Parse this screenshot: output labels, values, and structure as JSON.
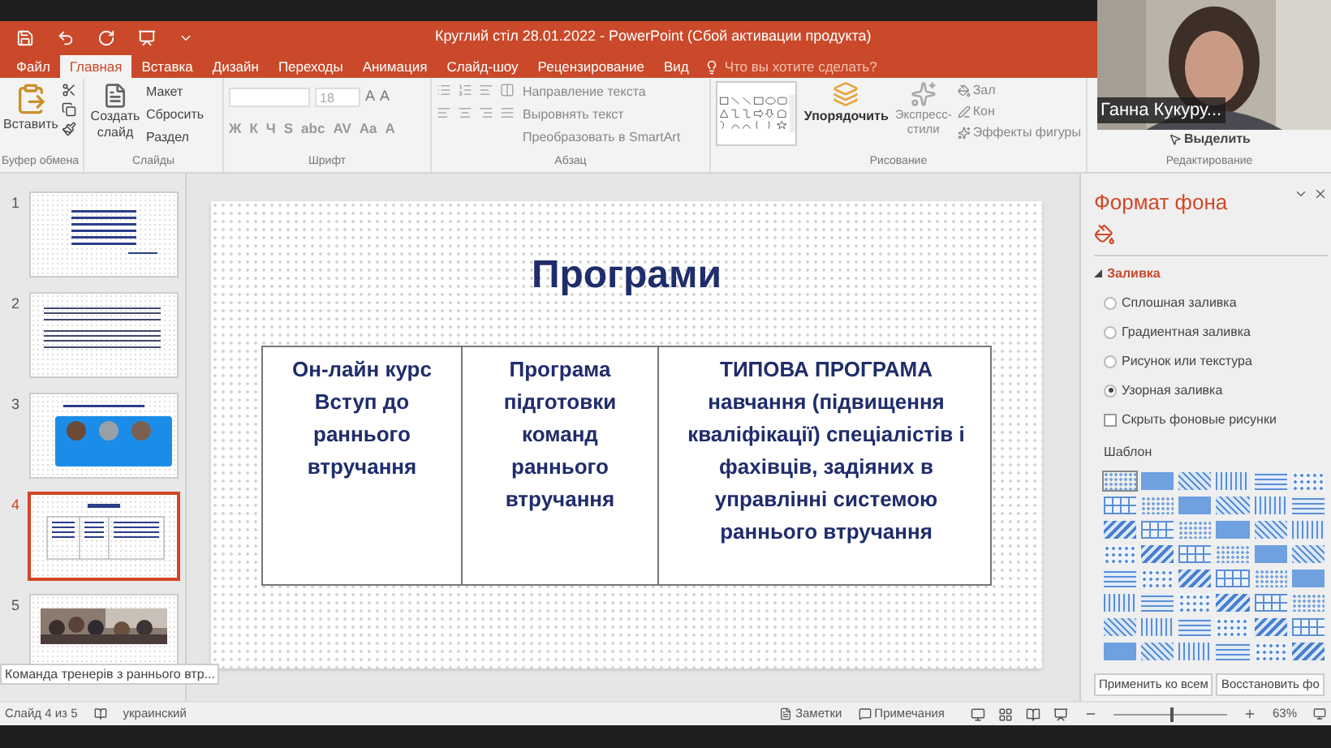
{
  "window": {
    "title": "Круглий стіл 28.01.2022 - PowerPoint (Сбой активации продукта)"
  },
  "tabs": [
    {
      "label": "Файл",
      "selected": false
    },
    {
      "label": "Главная",
      "selected": true
    },
    {
      "label": "Вставка",
      "selected": false
    },
    {
      "label": "Дизайн",
      "selected": false
    },
    {
      "label": "Переходы",
      "selected": false
    },
    {
      "label": "Анимация",
      "selected": false
    },
    {
      "label": "Слайд-шоу",
      "selected": false
    },
    {
      "label": "Рецензирование",
      "selected": false
    },
    {
      "label": "Вид",
      "selected": false
    }
  ],
  "tell_me": {
    "placeholder": "Что вы хотите сделать?"
  },
  "ribbon": {
    "clipboard": {
      "paste": "Вставить",
      "label": "Буфер обмена"
    },
    "slides": {
      "new_slide": "Создать слайд",
      "layout": "Макет",
      "reset": "Сбросить",
      "section": "Раздел",
      "label": "Слайды"
    },
    "font": {
      "size": "18",
      "size_buttons": [
        "A",
        "A"
      ],
      "format_buttons": [
        "Ж",
        "К",
        "Ч",
        "S",
        "abc",
        "AV",
        "Aa",
        "A"
      ],
      "label": "Шрифт"
    },
    "paragraph": {
      "commands": [
        "Направление текста",
        "Выровнять текст",
        "Преобразовать в SmartArt"
      ],
      "label": "Абзац"
    },
    "drawing": {
      "arrange": "Упорядочить",
      "quick_styles": "Экспресс-стили",
      "commands": [
        "Зал",
        "Кон",
        "Эффекты фигуры"
      ],
      "label": "Рисование"
    },
    "editing": {
      "select": "Выделить",
      "label": "Редактирование"
    }
  },
  "video": {
    "name": "Ганна Кукуру..."
  },
  "slides": [
    {
      "number": "1",
      "kind": "title",
      "selected": false
    },
    {
      "number": "2",
      "kind": "text",
      "selected": false
    },
    {
      "number": "3",
      "kind": "circles",
      "selected": false
    },
    {
      "number": "4",
      "kind": "table",
      "selected": true
    },
    {
      "number": "5",
      "selected": false
    }
  ],
  "tooltip": "Команда тренерів з раннього втр...",
  "slide": {
    "title": "Програми",
    "cells": [
      "Он-лайн курс Вступ до раннього втручання",
      "Програма підготовки команд раннього втручання",
      "ТИПОВА ПРОГРАМА навчання (підвищення кваліфікації) спеціалістів і фахівців, задіяних в управлінні системою раннього втручання"
    ]
  },
  "format_pane": {
    "title": "Формат фона",
    "section": "Заливка",
    "options": [
      {
        "label": "Сплошная заливка",
        "selected": false
      },
      {
        "label": "Градиентная заливка",
        "selected": false
      },
      {
        "label": "Рисунок или текстура",
        "selected": false
      },
      {
        "label": "Узорная заливка",
        "selected": true
      }
    ],
    "hide_graphics": {
      "label": "Скрыть фоновые рисунки",
      "checked": false
    },
    "patterns_label": "Шаблон",
    "patterns": [
      {
        "selected": true
      },
      {
        "selected": false
      },
      {
        "selected": false
      },
      {
        "selected": false
      },
      {
        "selected": false
      },
      {
        "selected": false
      },
      {
        "selected": false
      },
      {
        "selected": false
      },
      {
        "selected": false
      },
      {
        "selected": false
      },
      {
        "selected": false
      },
      {
        "selected": false
      },
      {
        "selected": false
      },
      {
        "selected": false
      },
      {
        "selected": false
      },
      {
        "selected": false
      },
      {
        "selected": false
      },
      {
        "selected": false
      },
      {
        "selected": false
      },
      {
        "selected": false
      },
      {
        "selected": false
      },
      {
        "selected": false
      },
      {
        "selected": false
      },
      {
        "selected": false
      },
      {
        "selected": false
      },
      {
        "selected": false
      },
      {
        "selected": false
      },
      {
        "selected": false
      },
      {
        "selected": false
      },
      {
        "selected": false
      },
      {
        "selected": false
      },
      {
        "selected": false
      },
      {
        "selected": false
      },
      {
        "selected": false
      },
      {
        "selected": false
      },
      {
        "selected": false
      },
      {
        "selected": false
      },
      {
        "selected": false
      },
      {
        "selected": false
      },
      {
        "selected": false
      },
      {
        "selected": false
      },
      {
        "selected": false
      },
      {
        "selected": false
      },
      {
        "selected": false
      },
      {
        "selected": false
      },
      {
        "selected": false
      },
      {
        "selected": false
      },
      {
        "selected": false
      }
    ],
    "buttons": [
      "Применить ко всем",
      "Восстановить фо"
    ]
  },
  "status_bar": {
    "slide": "Слайд 4 из 5",
    "language": "украинский",
    "notes": "Заметки",
    "comments": "Примечания",
    "zoom": "63%",
    "zoom_level": {
      "level": 0.5
    }
  }
}
